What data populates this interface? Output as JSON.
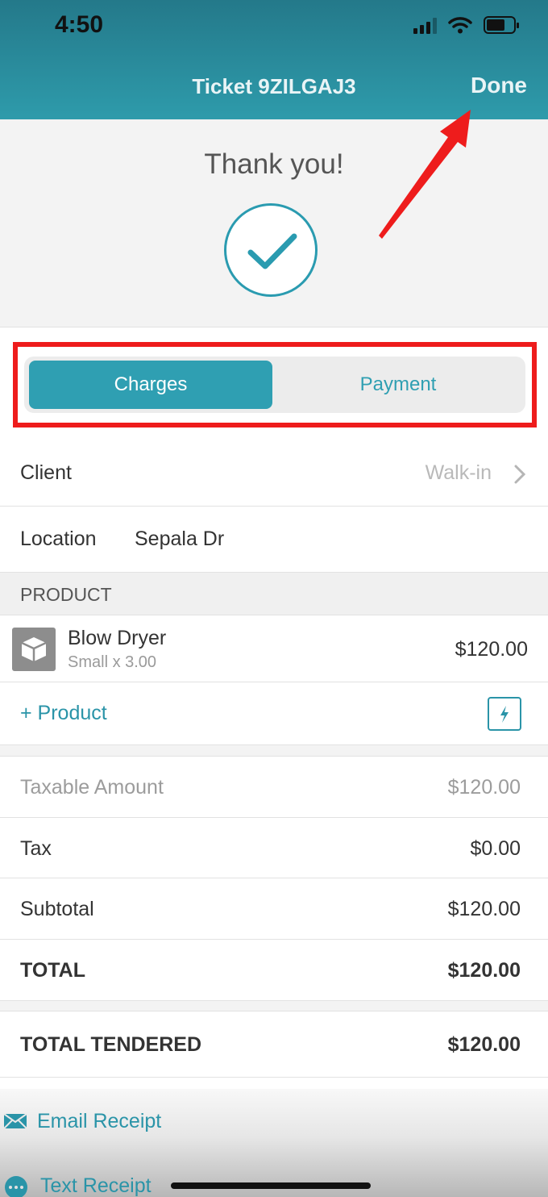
{
  "status_bar": {
    "time": "4:50"
  },
  "nav": {
    "title": "Ticket 9ZILGAJ3",
    "done_label": "Done"
  },
  "confirmation": {
    "message": "Thank you!"
  },
  "segmented": {
    "charges_label": "Charges",
    "payment_label": "Payment",
    "selected": "Charges"
  },
  "client": {
    "label": "Client",
    "value": "Walk-in"
  },
  "location": {
    "label": "Location",
    "value": "Sepala Dr"
  },
  "product_section": {
    "header": "PRODUCT"
  },
  "product_item": {
    "name": "Blow Dryer",
    "detail": "Small x 3.00",
    "price": "$120.00"
  },
  "add_product": {
    "label": "+ Product"
  },
  "totals": {
    "taxable_label": "Taxable Amount",
    "taxable_value": "$120.00",
    "tax_label": "Tax",
    "tax_value": "$0.00",
    "subtotal_label": "Subtotal",
    "subtotal_value": "$120.00",
    "total_label": "TOTAL",
    "total_value": "$120.00",
    "tendered_label": "TOTAL TENDERED",
    "tendered_value": "$120.00"
  },
  "receipts": {
    "email_label": "Email Receipt",
    "text_label": "Text Receipt"
  },
  "colors": {
    "accent": "#2f9fb2",
    "annotation": "#ee1c1c"
  }
}
